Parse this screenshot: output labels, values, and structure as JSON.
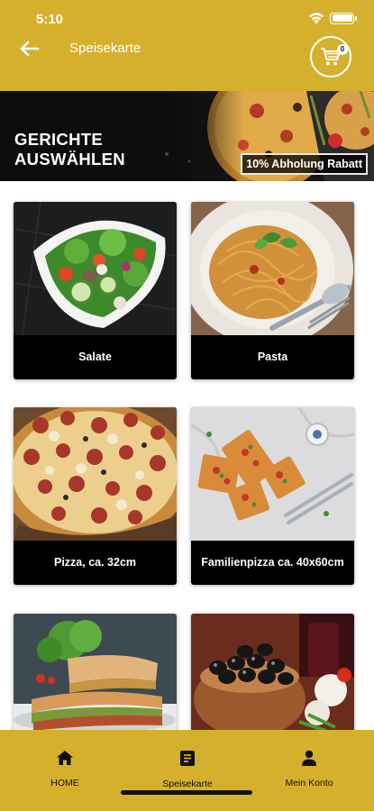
{
  "status": {
    "time": "5:10"
  },
  "header": {
    "title": "Speisekarte",
    "cart_count": "0"
  },
  "banner": {
    "title": "GERICHTE\nAUSWÄHLEN",
    "badge": "10% Abholung Rabatt"
  },
  "categories": [
    {
      "label": "Salate"
    },
    {
      "label": "Pasta"
    },
    {
      "label": "Pizza, ca. 32cm"
    },
    {
      "label": "Familienpizza ca. 40x60cm"
    },
    {
      "label": ""
    },
    {
      "label": ""
    }
  ],
  "bottom_nav": [
    {
      "label": "HOME",
      "icon": "home-icon"
    },
    {
      "label": "Speisekarte",
      "icon": "menu-book-icon"
    },
    {
      "label": "Mein Konto",
      "icon": "person-icon"
    }
  ],
  "colors": {
    "brand_gold": "#d5b02c",
    "card_black": "#000000",
    "text_white": "#ffffff"
  }
}
